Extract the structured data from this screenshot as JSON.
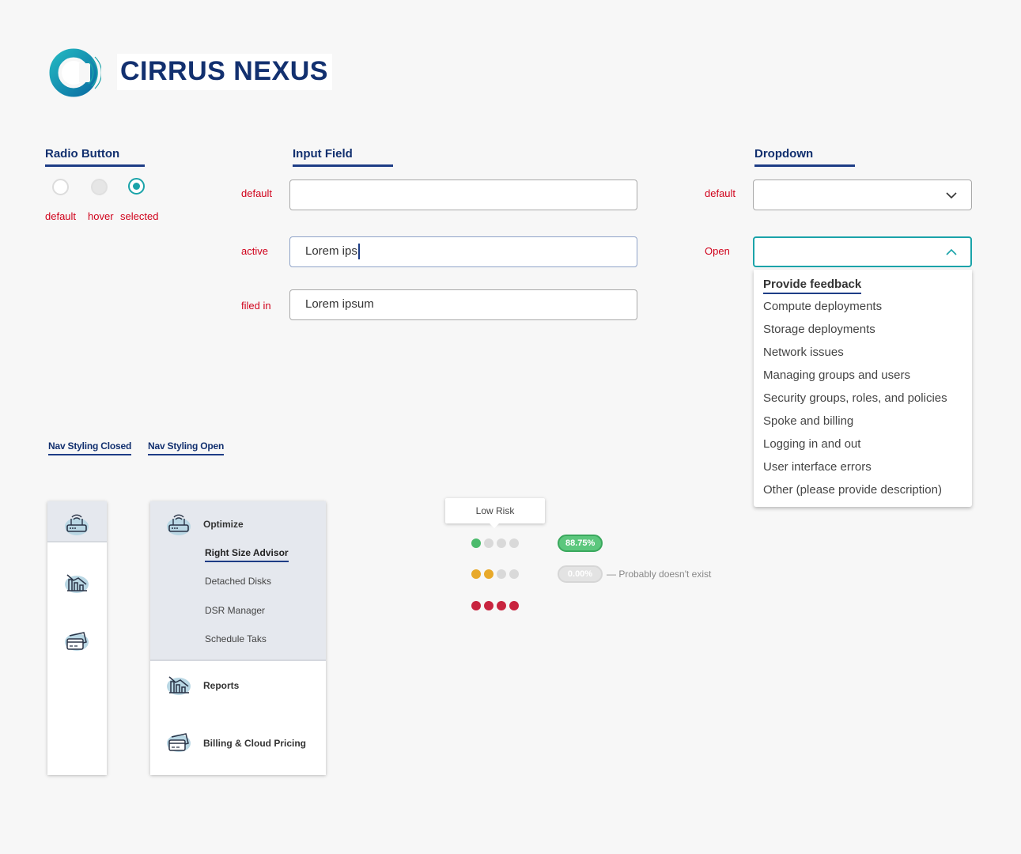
{
  "brand": {
    "name": "CIRRUS NEXUS",
    "colors": {
      "navy": "#12306f",
      "teal": "#1aa3a9",
      "error_red": "#d0021b"
    }
  },
  "radio": {
    "title": "Radio Button",
    "states": [
      "default",
      "hover",
      "selected"
    ]
  },
  "input": {
    "title": "Input Field",
    "rows": [
      {
        "label": "default",
        "value": ""
      },
      {
        "label": "active",
        "value": "Lorem ips"
      },
      {
        "label": "filed in",
        "value": "Lorem ipsum"
      }
    ]
  },
  "dropdown": {
    "title": "Dropdown",
    "rows": [
      {
        "label": "default",
        "icon": "chevron-down-icon"
      },
      {
        "label": "Open",
        "icon": "chevron-up-icon"
      }
    ],
    "options": [
      "Provide feedback",
      "Compute deployments",
      "Storage deployments",
      "Network issues",
      "Managing groups and users",
      "Security groups, roles, and policies",
      "Spoke and billing",
      "Logging in and out",
      "User interface errors",
      "Other (please provide description)"
    ]
  },
  "nav": {
    "closed_title": "Nav Styling Closed",
    "open_title": "Nav Styling Open",
    "closed_icons": [
      "router-icon",
      "chart-down-icon",
      "credit-card-icon"
    ],
    "open": {
      "optimize": {
        "label": "Optimize",
        "icon": "router-icon"
      },
      "sub_items": [
        "Right Size Advisor",
        "Detached Disks",
        "DSR Manager",
        "Schedule Taks"
      ],
      "active_sub": "Right Size Advisor",
      "reports": {
        "label": "Reports",
        "icon": "chart-down-icon"
      },
      "billing": {
        "label": "Billing & Cloud Pricing",
        "icon": "credit-card-icon"
      }
    }
  },
  "risk": {
    "tooltip": "Low Risk",
    "rows": [
      {
        "filled": 1,
        "color": "#4cbb6c",
        "badge": "88.75%",
        "badge_style": "green",
        "note": ""
      },
      {
        "filled": 2,
        "color": "#e8a92a",
        "badge": "0.00%",
        "badge_style": "grey",
        "note": "— Probably doesn't exist"
      },
      {
        "filled": 4,
        "color": "#c8243f",
        "badge": "",
        "badge_style": "",
        "note": ""
      }
    ]
  }
}
